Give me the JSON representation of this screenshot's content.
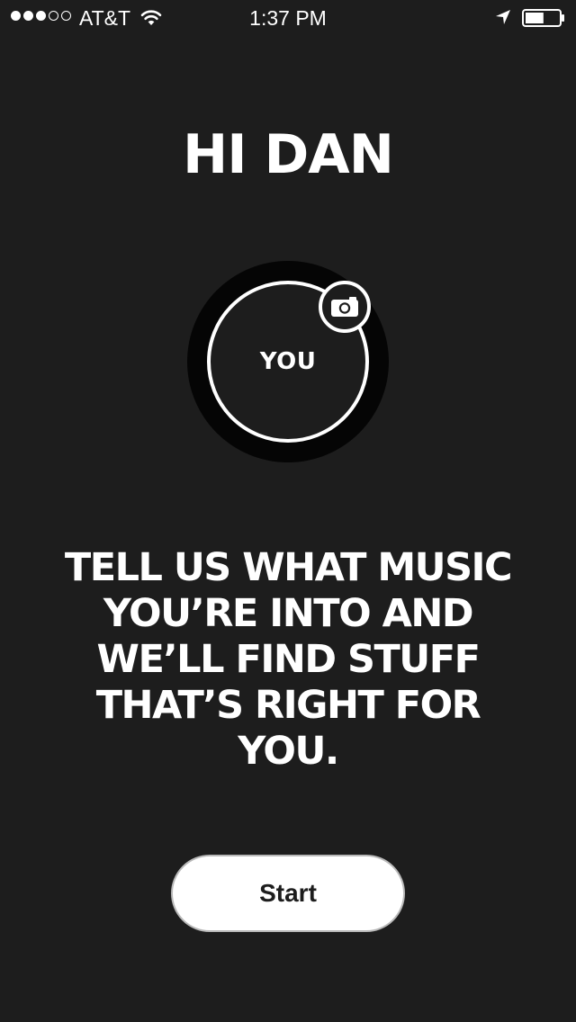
{
  "status_bar": {
    "signal_bars_filled": 3,
    "signal_bars_total": 5,
    "carrier": "AT&T",
    "time": "1:37 PM",
    "wifi_icon": "wifi-icon",
    "location_icon": "location-arrow-icon",
    "battery_icon": "battery-icon",
    "battery_level": 0.55
  },
  "main": {
    "greeting": "HI DAN",
    "avatar": {
      "label": "YOU",
      "camera_icon": "camera-icon"
    },
    "tagline_lines": [
      "TELL US WHAT MUSIC",
      "YOU’RE INTO AND",
      "WE’LL FIND STUFF",
      "THAT’S RIGHT FOR",
      "YOU."
    ],
    "start_button_label": "Start"
  },
  "colors": {
    "background": "#1d1d1d",
    "avatar_ring_shadow": "#050505",
    "text": "#ffffff",
    "button_background": "#ffffff",
    "button_text": "#1d1d1d"
  }
}
